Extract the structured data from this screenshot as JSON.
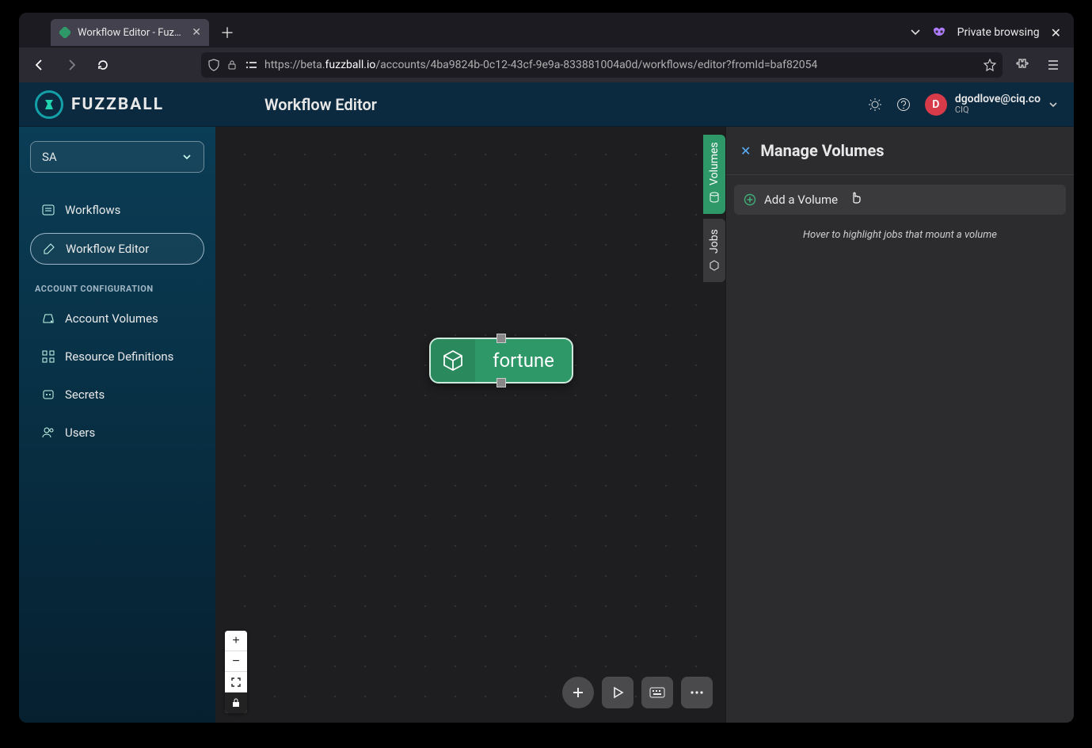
{
  "browser": {
    "tab_title": "Workflow Editor - Fuzzba",
    "private_label": "Private browsing",
    "url_protocol": "https://",
    "url_sub": "beta.",
    "url_host": "fuzzball.io",
    "url_path": "/accounts/4ba9824b-0c12-43cf-9e9a-833881004a0d/workflows/editor?fromId=baf82054"
  },
  "app": {
    "product_name": "FUZZBALL",
    "page_title": "Workflow Editor"
  },
  "user": {
    "avatar_initial": "D",
    "email": "dgodlove@ciq.co",
    "org": "CIQ"
  },
  "sidebar": {
    "context_value": "SA",
    "section_label": "ACCOUNT CONFIGURATION",
    "items": {
      "workflows": "Workflows",
      "workflow_editor": "Workflow Editor",
      "account_volumes": "Account Volumes",
      "resource_definitions": "Resource Definitions",
      "secrets": "Secrets",
      "users": "Users"
    }
  },
  "canvas": {
    "node_label": "fortune",
    "side_tabs": {
      "volumes": "Volumes",
      "jobs": "Jobs"
    }
  },
  "panel": {
    "title": "Manage Volumes",
    "add_button": "Add a Volume",
    "hint": "Hover to highlight jobs that mount a volume"
  }
}
